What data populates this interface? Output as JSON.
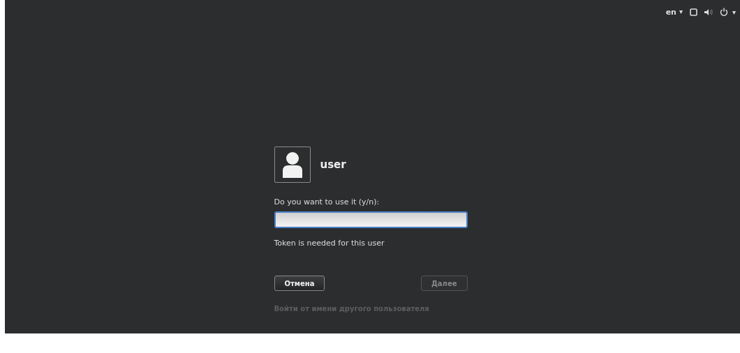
{
  "top_bar": {
    "language": "en",
    "menu_caret": "▾",
    "power_caret": "▾"
  },
  "login": {
    "user_name": "user",
    "prompt": "Do you want to use it (y/n):",
    "field": {
      "focused": true
    },
    "message": "Token is needed for this user",
    "buttons": [
      {
        "label": "Отмена",
        "disabled": false
      },
      {
        "label": "Далее",
        "disabled": true
      }
    ],
    "other_user_link": "Войти от имени другого пользователя"
  }
}
